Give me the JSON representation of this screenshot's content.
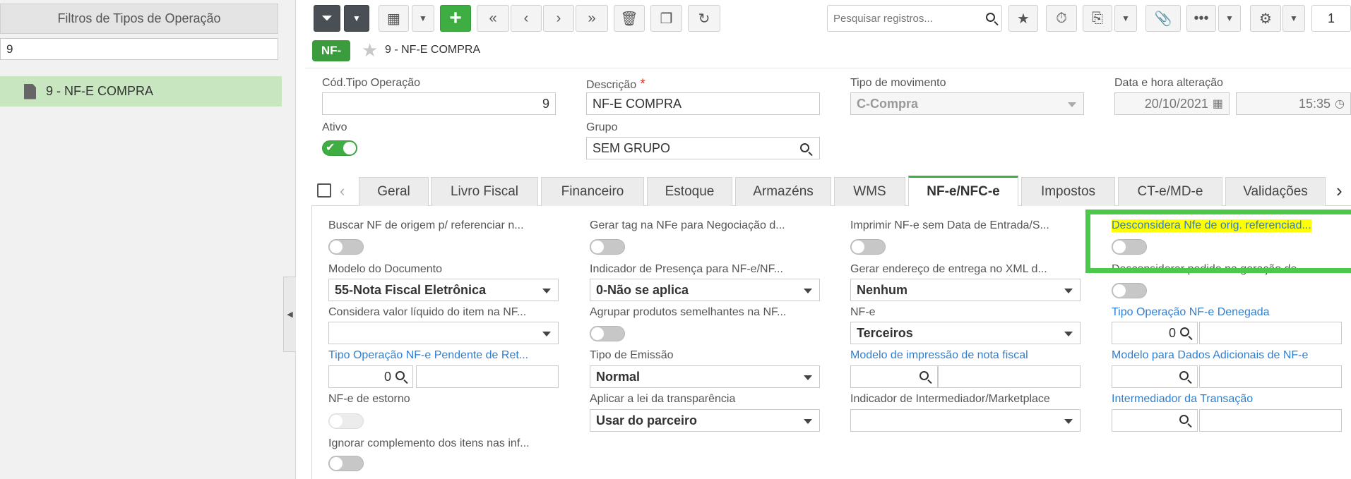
{
  "left_panel": {
    "title": "Filtros de Tipos de Operação",
    "filter_value": "9",
    "tree_item": "9 - NF-E COMPRA"
  },
  "toolbar": {
    "search_placeholder": "Pesquisar registros...",
    "page_value": "1",
    "icons": [
      "filter-icon",
      "chevron-down-icon",
      "grid-icon",
      "chevron-down-icon",
      "add-icon",
      "first-icon",
      "prev-icon",
      "next-icon",
      "last-icon",
      "trash-icon",
      "copy-icon",
      "refresh-icon",
      "search-icon",
      "star-icon",
      "timer-icon",
      "export-icon",
      "chevron-down-icon",
      "attach-icon",
      "more-icon",
      "chevron-down-icon",
      "gear-icon",
      "chevron-down-icon"
    ]
  },
  "record": {
    "badge": "NF-",
    "title": "9 - NF-E COMPRA"
  },
  "header_fields": {
    "cod_label": "Cód.Tipo Operação",
    "cod_value": "9",
    "desc_label": "Descrição",
    "desc_value": "NF-E COMPRA",
    "mov_label": "Tipo de movimento",
    "mov_value": "C-Compra",
    "data_label": "Data e hora alteração",
    "data_value": "20/10/2021",
    "hora_value": "15:35",
    "ativo_label": "Ativo",
    "ativo_on": true,
    "grupo_label": "Grupo",
    "grupo_value": "SEM GRUPO"
  },
  "tabs": [
    "Geral",
    "Livro Fiscal",
    "Financeiro",
    "Estoque",
    "Armazéns",
    "WMS",
    "NF-e/NFC-e",
    "Impostos",
    "CT-e/MD-e",
    "Validações"
  ],
  "active_tab": "NF-e/NFC-e",
  "form": {
    "c1": {
      "buscar_label": "Buscar NF de origem p/ referenciar n...",
      "modelo_label": "Modelo do Documento",
      "modelo_value": "55-Nota Fiscal Eletrônica",
      "considera_label": "Considera valor líquido do item na NF...",
      "considera_value": "",
      "pend_label": "Tipo Operação NF-e Pendente de Ret...",
      "pend_value": "0",
      "estorno_label": "NF-e de estorno",
      "ignorar_label": "Ignorar complemento dos itens nas inf..."
    },
    "c2": {
      "gerar_tag_label": "Gerar tag na NFe para Negociação d...",
      "indicador_label": "Indicador de Presença para NF-e/NF...",
      "indicador_value": "0-Não se aplica",
      "agrupar_label": "Agrupar produtos semelhantes na NF...",
      "emissao_label": "Tipo de Emissão",
      "emissao_value": "Normal",
      "lei_label": "Aplicar a lei da transparência",
      "lei_value": "Usar do parceiro"
    },
    "c3": {
      "imprimir_label": "Imprimir NF-e sem Data de Entrada/S...",
      "gerar_end_label": "Gerar endereço de entrega no XML d...",
      "gerar_end_value": "Nenhum",
      "nfe_label": "NF-e",
      "nfe_value": "Terceiros",
      "modelo_imp_label": "Modelo de impressão de nota fiscal",
      "intermediador_label": "Indicador de Intermediador/Marketplace",
      "intermediador_value": ""
    },
    "c4": {
      "desconsidera_label": "Desconsidera Nfe de orig. referenciad...",
      "desconsiderar_pedido_label": "Desconsiderar pedido na geração de ...",
      "denegada_label": "Tipo Operação NF-e Denegada",
      "denegada_value": "0",
      "modelo_dados_label": "Modelo para Dados Adicionais de NF-e",
      "intermed_trans_label": "Intermediador da Transação"
    }
  },
  "colors": {
    "accent": "#3fae42",
    "highlight": "#ffff00",
    "link": "#2f7fd1"
  }
}
